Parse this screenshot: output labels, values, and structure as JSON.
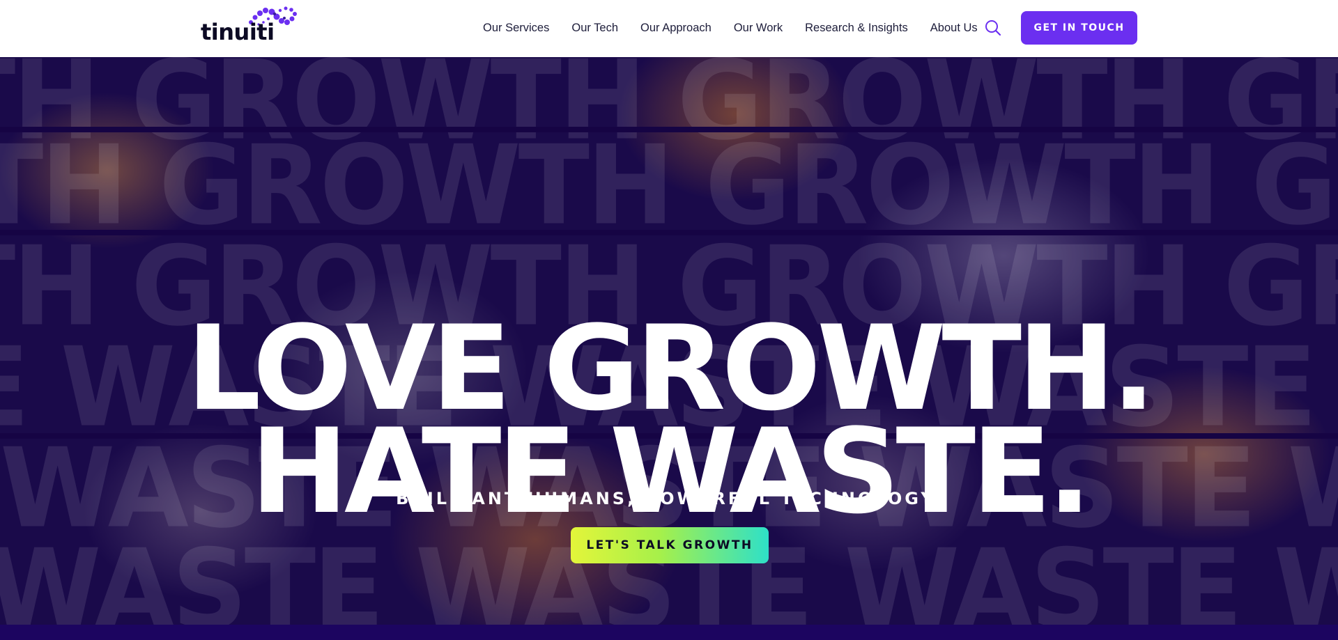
{
  "header": {
    "logo_text": "tinuiti",
    "nav": [
      {
        "label": "Our Services"
      },
      {
        "label": "Our Tech"
      },
      {
        "label": "Our Approach"
      },
      {
        "label": "Our Work"
      },
      {
        "label": "Research & Insights"
      },
      {
        "label": "About Us"
      }
    ],
    "search_icon": "search-icon",
    "cta_label": "GET IN TOUCH"
  },
  "hero": {
    "background_words": [
      "TH GROWTH GROWTH GROWTH GROW",
      "TH GROWTH GROWTH GROWTH GROW",
      "TH GROWTH GROWTH GROWTH GROW",
      "E WASTE WASTE WASTE WASTE WAS",
      "WASTE WASTE WASTE WASTE WASTE",
      "WASTE WASTE WASTE WASTE WAS"
    ],
    "headline_line1": "LOVE GROWTH.",
    "headline_line2": "HATE WASTE.",
    "subheadline": "BRILLIANT HUMANS, POWERFUL TECHNOLOGY.",
    "button_label": "LET'S TALK GROWTH"
  },
  "colors": {
    "brand_purple": "#6b2ff0",
    "hero_background": "#170645",
    "cta_gradient_start": "#e3f53a",
    "cta_gradient_end": "#2ee0c8"
  }
}
